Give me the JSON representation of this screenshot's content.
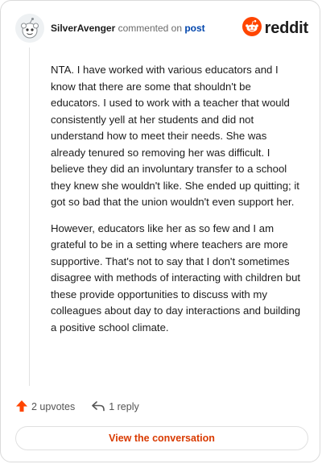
{
  "header": {
    "username": "SilverAvenger",
    "action": "commented on",
    "post_link": "post",
    "logo_text": "reddit"
  },
  "comment": {
    "paragraphs": [
      "NTA. I have worked with various educators and I know that there are some that shouldn't be educators. I used to work with a teacher that would consistently yell at her students and did not understand how to meet their needs. She was already tenured so removing her was difficult. I believe they did an involuntary transfer to a school they knew she wouldn't like. She ended up quitting; it got so bad that the union wouldn't even support her.",
      "However, educators like her as so few and I am grateful to be in a setting where teachers are more supportive. That's not to say that I don't sometimes disagree with methods of interacting with children but these provide opportunities to discuss with my colleagues about day to day interactions and building a positive school climate."
    ]
  },
  "actions": {
    "upvotes": "2 upvotes",
    "replies": "1 reply"
  },
  "footer": {
    "view_button": "View the conversation"
  },
  "icons": {
    "avatar": "snoo-avatar-icon",
    "logo": "reddit-logo-icon",
    "upvote": "upvote-arrow-icon",
    "reply": "reply-arrow-icon"
  },
  "colors": {
    "brand_orange": "#ff4500",
    "button_text": "#d93a00",
    "link_blue": "#0045ac"
  }
}
